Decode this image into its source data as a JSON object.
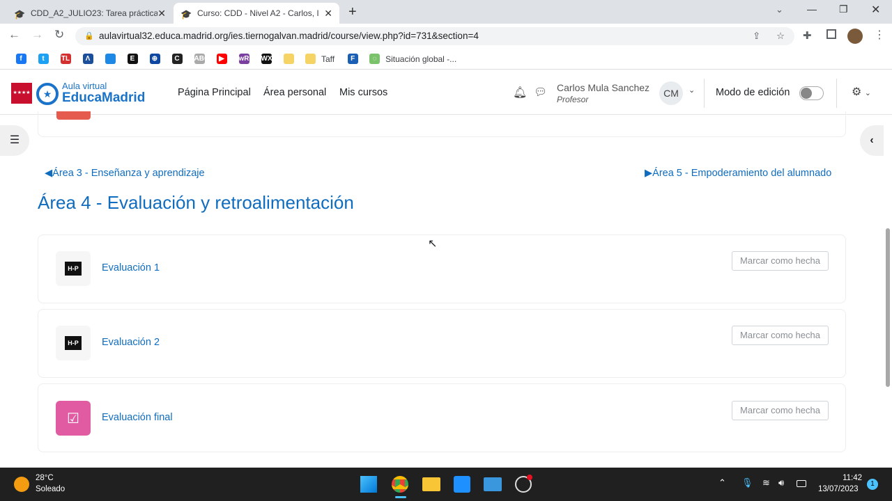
{
  "browser": {
    "tabs": [
      {
        "title": "CDD_A2_JULIO23: Tarea práctica",
        "active": false
      },
      {
        "title": "Curso: CDD - Nivel A2 - Carlos, I",
        "active": true
      }
    ],
    "url": "aulavirtual32.educa.madrid.org/ies.tiernogalvan.madrid/course/view.php?id=731&section=4",
    "bookmarks": [
      {
        "label": "",
        "color": "#1877f2",
        "text": "f"
      },
      {
        "label": "",
        "color": "#1da1f2",
        "text": "t"
      },
      {
        "label": "",
        "color": "#d32f2f",
        "text": "TL"
      },
      {
        "label": "",
        "color": "#1b4f9c",
        "text": "Λ"
      },
      {
        "label": "",
        "color": "#1e88e5",
        "text": ""
      },
      {
        "label": "",
        "color": "#111111",
        "text": "E"
      },
      {
        "label": "",
        "color": "#0d47a1",
        "text": "⊕"
      },
      {
        "label": "",
        "color": "#222222",
        "text": "C"
      },
      {
        "label": "",
        "color": "#aaaaaa",
        "text": "ABC"
      },
      {
        "label": "",
        "color": "#ff0000",
        "text": "▶"
      },
      {
        "label": "",
        "color": "#7b3fa0",
        "text": "wR"
      },
      {
        "label": "",
        "color": "#111111",
        "text": "WX"
      },
      {
        "label": "",
        "color": "#f6d365",
        "text": ""
      },
      {
        "label": "Taff",
        "color": "#f6d365",
        "text": ""
      },
      {
        "label": "",
        "color": "#1a5fb4",
        "text": "F"
      },
      {
        "label": "Situación global -...",
        "color": "#7ac36a",
        "text": "◌"
      }
    ]
  },
  "site": {
    "logo_top": "Aula virtual",
    "logo_bottom": "EducaMadrid",
    "nav": [
      "Página Principal",
      "Área personal",
      "Mis cursos"
    ],
    "user_name": "Carlos Mula Sanchez",
    "user_role": "Profesor",
    "initials": "CM",
    "edit_mode": "Modo de edición",
    "edit_mode_on": false
  },
  "section": {
    "prev": "◀Área 3 - Enseñanza y aprendizaje",
    "next": "▶Área 5 - Empoderamiento del alumnado",
    "title": "Área 4 - Evaluación y retroalimentación",
    "activities": [
      {
        "name": "Evaluación 1",
        "icon": "h5p-icon",
        "icon_text": "H-P",
        "button": "Marcar como hecha"
      },
      {
        "name": "Evaluación 2",
        "icon": "h5p-icon",
        "icon_text": "H-P",
        "button": "Marcar como hecha"
      },
      {
        "name": "Evaluación final",
        "icon": "assignment-icon",
        "icon_text": "☑",
        "button": "Marcar como hecha"
      }
    ]
  },
  "taskbar": {
    "temp": "28°C",
    "weather": "Soleado",
    "time": "11:42",
    "date": "13/07/2023",
    "notifications": "1"
  }
}
